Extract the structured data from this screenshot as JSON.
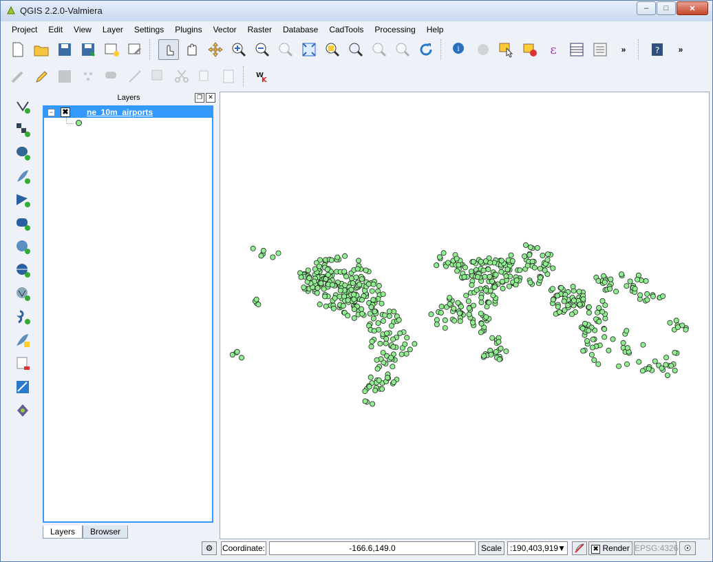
{
  "window": {
    "title": "QGIS 2.2.0-Valmiera"
  },
  "menu": [
    "Project",
    "Edit",
    "View",
    "Layer",
    "Settings",
    "Plugins",
    "Vector",
    "Raster",
    "Database",
    "CadTools",
    "Processing",
    "Help"
  ],
  "layers_panel": {
    "title": "Layers",
    "layer_name": "ne_10m_airports",
    "tabs": [
      "Layers",
      "Browser"
    ]
  },
  "status": {
    "coordinate_label": "Coordinate:",
    "coordinate_value": "-166.6,149.0",
    "scale_label": "Scale",
    "scale_value": ":190,403,919",
    "render_label": "Render",
    "crs": "EPSG:4326"
  },
  "colors": {
    "point_fill": "#90ee90",
    "selection": "#3399ff"
  }
}
